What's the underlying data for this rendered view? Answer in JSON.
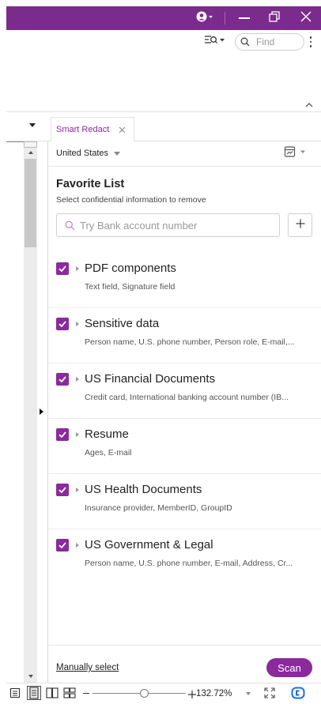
{
  "colors": {
    "accent": "#7b2b8c",
    "checkbox": "#8a2a9c",
    "search_icon": "#c08acb"
  },
  "toolbar": {
    "find_placeholder": "Find"
  },
  "tabs": [
    {
      "label": "Smart Redact"
    }
  ],
  "panel": {
    "region": "United States",
    "heading": "Favorite List",
    "subheading": "Select confidential information to remove",
    "search_placeholder": "Try Bank account number",
    "items": [
      {
        "title": "PDF components",
        "desc": "Text field, Signature field",
        "checked": true
      },
      {
        "title": "Sensitive data",
        "desc": "Person name, U.S. phone number, Person role, E-mail,...",
        "checked": true
      },
      {
        "title": "US Financial Documents",
        "desc": "Credit card, International banking account number (IB...",
        "checked": true
      },
      {
        "title": "Resume",
        "desc": "Ages, E-mail",
        "checked": true
      },
      {
        "title": "US Health Documents",
        "desc": "Insurance provider, MemberID, GroupID",
        "checked": true
      },
      {
        "title": "US Government & Legal",
        "desc": "Person name, U.S. phone number, E-mail, Address, Cr...",
        "checked": true
      }
    ],
    "manual_select": "Manually select",
    "scan_label": "Scan"
  },
  "statusbar": {
    "zoom": "132.72%",
    "zoom_fraction": 0.55
  }
}
